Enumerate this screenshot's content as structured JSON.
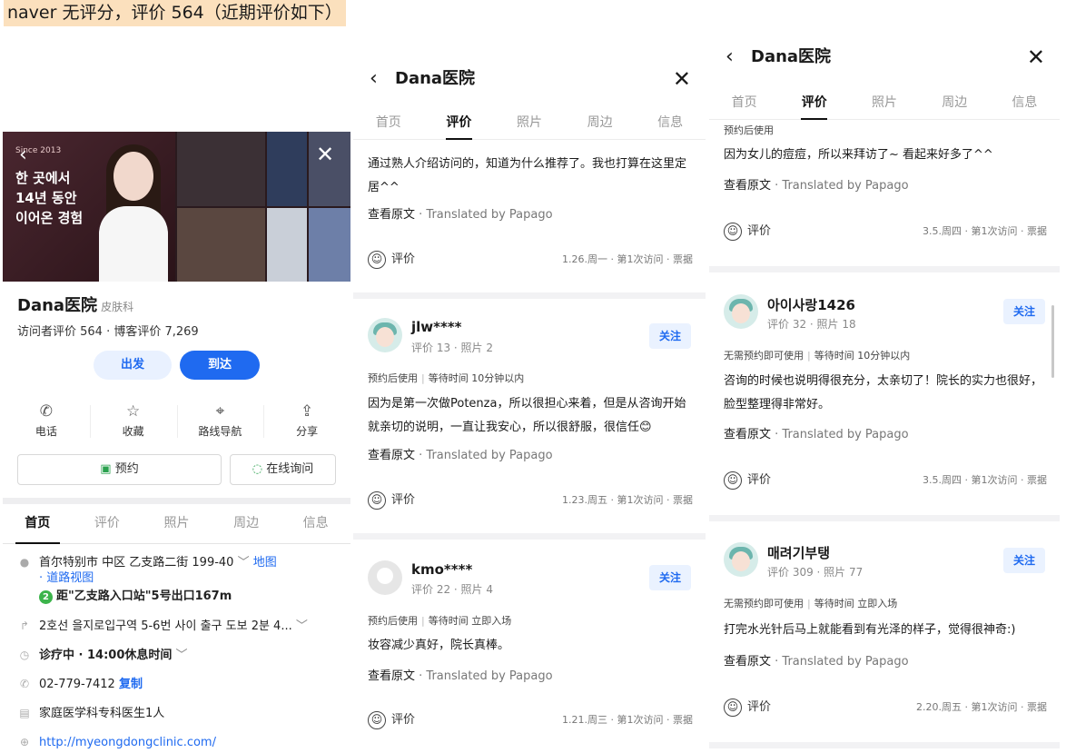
{
  "caption": "naver 无评分，评价 564（近期评价如下）",
  "place": {
    "hero_since": "Since 2013",
    "hero_text": [
      "한 곳에서",
      "14년 동안",
      "이어온 경험"
    ],
    "name": "Dana医院",
    "category": "皮肤科",
    "stats": "访问者评价 564 · 博客评价 7,269",
    "btn_depart": "出发",
    "btn_arrive": "到达",
    "actions": [
      {
        "icon": "phone-icon",
        "glyph": "✆",
        "label": "电话"
      },
      {
        "icon": "star-icon",
        "glyph": "☆",
        "label": "收藏"
      },
      {
        "icon": "navigation-icon",
        "glyph": "⌖",
        "label": "路线导航"
      },
      {
        "icon": "share-icon",
        "glyph": "⇪",
        "label": "分享"
      }
    ],
    "reserve": "预约",
    "inquiry": "在线询问",
    "tabs": [
      "首页",
      "评价",
      "照片",
      "周边",
      "信息"
    ],
    "address": "首尔特别市 中区 乙支路二街 199-40",
    "map_link": "地图",
    "road_view": "道路视图",
    "station_num": "2",
    "station": "距\"乙支路入口站\"5号出口167m",
    "directions": "2호선 을지로입구역 5-6번 사이 출구 도보 2분 4...",
    "hours": "诊疗中 · 14:00休息时间",
    "phone": "02-779-7412",
    "copy": "复制",
    "doctor": "家庭医学科专科医生1人",
    "website": "http://myeongdongclinic.com/"
  },
  "review_screens": {
    "title": "Dana医院",
    "tabs": [
      "首页",
      "评价",
      "照片",
      "周边",
      "信息"
    ],
    "show_original": "查看原文",
    "translated": "· Translated by Papago",
    "rate_label": "评价",
    "follow": "关注",
    "screen2": [
      {
        "text": "通过熟人介绍访问的，知道为什么推荐了。我也打算在这里定居^^",
        "meta": "1.26.周一 · 第1次访问 · 票据"
      },
      {
        "user": "jlw****",
        "sub": "评价 13 · 照片 2",
        "tag1": "预约后使用",
        "tag2": "等待时间 10分钟以内",
        "text": "因为是第一次做Potenza，所以很担心来着，但是从咨询开始就亲切的说明，一直让我安心，所以很舒服，很信任😊",
        "meta": "1.23.周五 · 第1次访问 · 票据"
      },
      {
        "user": "kmo****",
        "sub": "评价 22 · 照片 4",
        "tag1": "预约后使用",
        "tag2": "等待时间 立即入场",
        "text": "妆容减少真好，院长真棒。",
        "meta": "1.21.周三 · 第1次访问 · 票据"
      }
    ],
    "screen3": [
      {
        "tag1": "预约后使用",
        "text": "因为女儿的痘痘，所以来拜访了~ 看起来好多了^^",
        "meta": "3.5.周四 · 第1次访问 · 票据"
      },
      {
        "user": "아이사랑1426",
        "sub": "评价 32 · 照片 18",
        "tag1": "无需预约即可使用",
        "tag2": "等待时间 10分钟以内",
        "text": "咨询的时候也说明得很充分，太亲切了！院长的实力也很好，脸型整理得非常好。",
        "meta": "3.5.周四 · 第1次访问 · 票据"
      },
      {
        "user": "매려기부탱",
        "sub": "评价 309 · 照片 77",
        "tag1": "无需预约即可使用",
        "tag2": "等待时间 立即入场",
        "text": "打完水光针后马上就能看到有光泽的样子，觉得很神奇:)",
        "meta": "2.20.周五 · 第1次访问 · 票据"
      }
    ]
  },
  "colors": {
    "accent": "#1f6af0",
    "caption_bg": "#fbe0bd"
  }
}
